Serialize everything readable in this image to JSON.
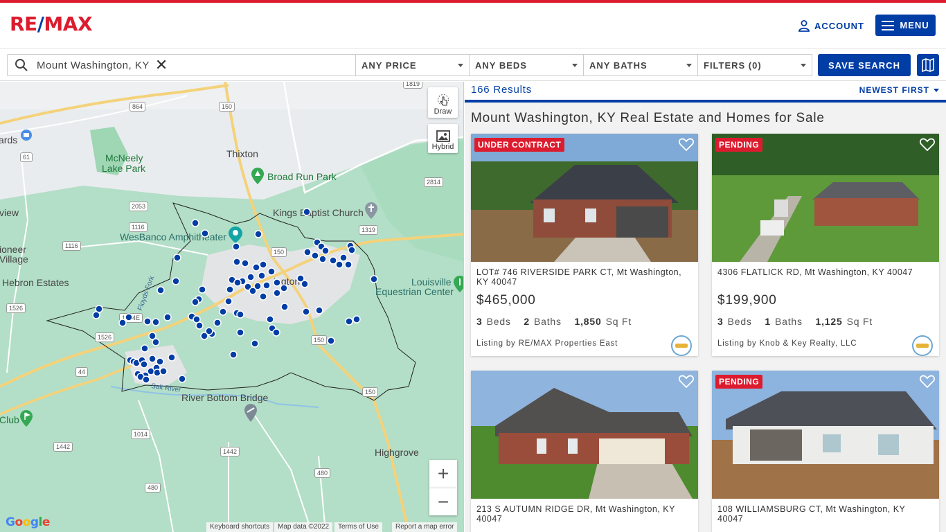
{
  "header": {
    "logo_left": "RE",
    "logo_slash": "/",
    "logo_right": "MAX",
    "account_label": "ACCOUNT",
    "menu_label": "MENU"
  },
  "search": {
    "location_value": "Mount Washington, KY",
    "filters": [
      {
        "label": "ANY PRICE"
      },
      {
        "label": "ANY BEDS"
      },
      {
        "label": "ANY BATHS"
      },
      {
        "label": "FILTERS (0)"
      }
    ],
    "save_label": "SAVE SEARCH"
  },
  "map": {
    "labels": {
      "thixton": "Thixton",
      "broad_run_park": "Broad Run Park",
      "mcneely_lake_park_1": "McNeely",
      "mcneely_lake_park_2": "Lake Park",
      "kings_baptist_church": "Kings Baptist Church",
      "wesbanco": "WesBanco Amphitheater",
      "louisville_equestrian_1": "Louisville",
      "louisville_equestrian_2": "Equestrian Center",
      "hebron_estates": "Hebron Estates",
      "pioneer_village_1": "ioneer",
      "pioneer_village_2": "Village",
      "view": "view",
      "ards": "ards",
      "river_bottom_bridge": "River Bottom Bridge",
      "salt_river": "Salt River",
      "highgrove": "Highgrove",
      "club": "Club",
      "floyds_fork": "Floyds Fork",
      "washington": "ington"
    },
    "shields": {
      "s1819": "1819",
      "s864": "864",
      "s150a": "150",
      "s61": "61",
      "s2053": "2053",
      "s1116a": "1116",
      "s1116b": "1116",
      "s2814": "2814",
      "s1319": "1319",
      "s150b": "150",
      "s150c": "150",
      "s1526a": "1526",
      "s1526b": "1526",
      "s1074e": "1074E",
      "s44": "44",
      "s150d": "150",
      "s1014": "1014",
      "s1442a": "1442",
      "s1442b": "1442",
      "s480a": "480",
      "s480b": "480"
    },
    "draw_label": "Draw",
    "hybrid_label": "Hybrid",
    "zoom_in": "+",
    "zoom_out": "−",
    "google": "Google",
    "attribution": {
      "shortcuts": "Keyboard shortcuts",
      "map_data": "Map data ©2022",
      "terms": "Terms of Use",
      "report": "Report a map error"
    },
    "marker_color": "#003da5"
  },
  "results": {
    "count": "166 Results",
    "sort_label": "NEWEST FIRST",
    "title": "Mount Washington, KY Real Estate and Homes for Sale",
    "listings": [
      {
        "badge": "UNDER CONTRACT",
        "address": "LOT# 746 RIVERSIDE PARK CT, Mt Washington, KY 40047",
        "price": "$465,000",
        "beds": "3",
        "beds_label": "Beds",
        "baths": "2",
        "baths_label": "Baths",
        "sqft": "1,850",
        "sqft_label": "Sq Ft",
        "broker": "Listing by RE/MAX Properties East"
      },
      {
        "badge": "PENDING",
        "address": "4306 FLATLICK RD, Mt Washington, KY 40047",
        "price": "$199,900",
        "beds": "3",
        "beds_label": "Beds",
        "baths": "1",
        "baths_label": "Baths",
        "sqft": "1,125",
        "sqft_label": "Sq Ft",
        "broker": "Listing by Knob & Key Realty, LLC"
      },
      {
        "badge": "",
        "address": "213 S AUTUMN RIDGE DR, Mt Washington, KY 40047"
      },
      {
        "badge": "PENDING",
        "address": "108 WILLIAMSBURG CT, Mt Washington, KY 40047"
      }
    ]
  },
  "colors": {
    "brand_red": "#dc1c2e",
    "brand_blue": "#003da5"
  }
}
